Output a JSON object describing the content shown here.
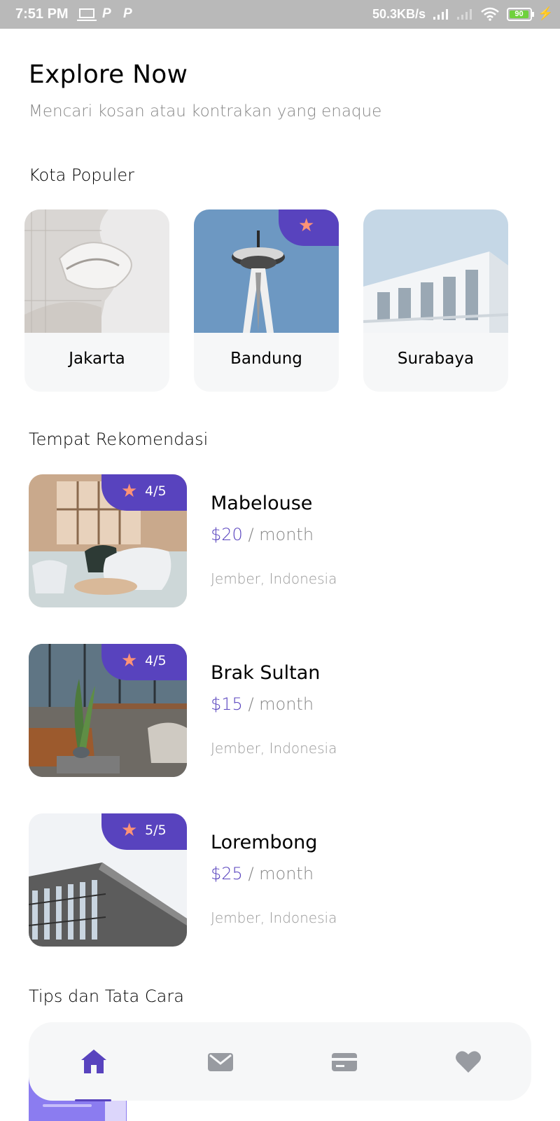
{
  "status_bar": {
    "time": "7:51 PM",
    "net_speed": "50.3KB/s",
    "battery": "90",
    "notif_icons": [
      "P",
      "P"
    ]
  },
  "header": {
    "title": "Explore Now",
    "subtitle": "Mencari kosan atau kontrakan yang enaque"
  },
  "sections": {
    "popular_cities": "Kota Populer",
    "recommended": "Tempat Rekomendasi",
    "tips": "Tips dan Tata Cara"
  },
  "cities": [
    {
      "name": "Jakarta",
      "popular": false
    },
    {
      "name": "Bandung",
      "popular": true
    },
    {
      "name": "Surabaya",
      "popular": false
    }
  ],
  "places": [
    {
      "name": "Mabelouse",
      "price": "$20",
      "per": " / month",
      "location": "Jember, Indonesia",
      "rating": "4/5"
    },
    {
      "name": "Brak Sultan",
      "price": "$15",
      "per": " / month",
      "location": "Jember, Indonesia",
      "rating": "4/5"
    },
    {
      "name": "Lorembong",
      "price": "$25",
      "per": " / month",
      "location": "Jember, Indonesia",
      "rating": "5/5"
    }
  ],
  "bottom_nav": {
    "items": [
      "home-icon",
      "mail-icon",
      "card-icon",
      "heart-icon"
    ],
    "active": "home-icon"
  },
  "colors": {
    "accent": "#5843be",
    "star": "#ff9376",
    "inactive_icon": "#989ba1",
    "active_icon": "#5843be",
    "card_bg": "#f6f7f8"
  }
}
